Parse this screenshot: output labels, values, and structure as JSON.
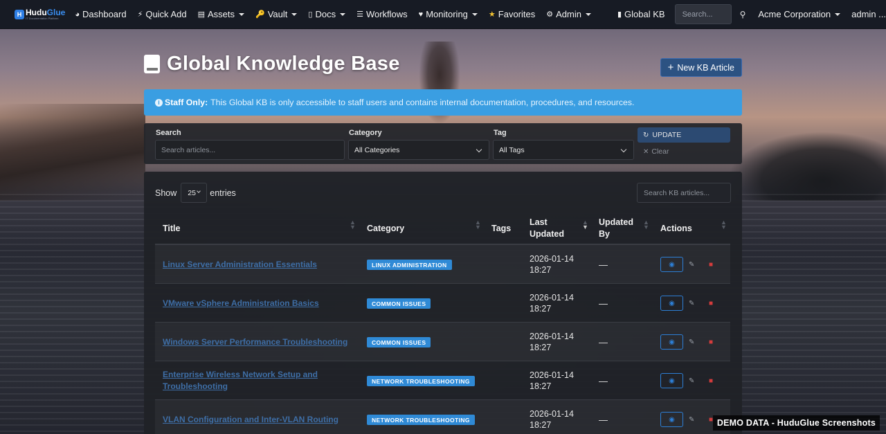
{
  "navbar": {
    "brand": {
      "badge": "H",
      "name_a": "Hudu",
      "name_b": "Glue",
      "tagline": "IT Documentation Platform"
    },
    "items": [
      {
        "icon": "dashboard-icon",
        "glyph": "◕",
        "label": "Dashboard"
      },
      {
        "icon": "bolt-icon",
        "glyph": "⚡",
        "label": "Quick Add"
      },
      {
        "icon": "assets-icon",
        "glyph": "▤",
        "label": "Assets",
        "dropdown": true
      },
      {
        "icon": "key-icon",
        "glyph": "🔑",
        "label": "Vault",
        "dropdown": true
      },
      {
        "icon": "doc-icon",
        "glyph": "▯",
        "label": "Docs",
        "dropdown": true
      },
      {
        "icon": "list-icon",
        "glyph": "☰",
        "label": "Workflows"
      },
      {
        "icon": "heart-icon",
        "glyph": "♥",
        "label": "Monitoring",
        "dropdown": true
      },
      {
        "icon": "star-icon",
        "glyph": "★",
        "label": "Favorites"
      },
      {
        "icon": "gear-icon",
        "glyph": "⚙",
        "label": "Admin",
        "dropdown": true
      }
    ],
    "global_kb": {
      "icon": "book-icon",
      "label": "Global KB"
    },
    "search_placeholder": "Search...",
    "org": "Acme Corporation",
    "user": "admin ..."
  },
  "page": {
    "title": "Global Knowledge Base",
    "new_button": "New KB Article",
    "alert": {
      "strong": "Staff Only:",
      "text": "This Global KB is only accessible to staff users and contains internal documentation, procedures, and resources."
    }
  },
  "filters": {
    "search_label": "Search",
    "search_placeholder": "Search articles...",
    "category_label": "Category",
    "category_value": "All Categories",
    "tag_label": "Tag",
    "tag_value": "All Tags",
    "update": "UPDATE",
    "clear": "Clear"
  },
  "table": {
    "show": "Show",
    "length": "25",
    "entries": "entries",
    "search_placeholder": "Search KB articles...",
    "headers": {
      "title": "Title",
      "category": "Category",
      "tags": "Tags",
      "updated_1": "Last",
      "updated_2": "Updated",
      "by_1": "Updated",
      "by_2": "By",
      "actions": "Actions"
    },
    "rows": [
      {
        "title": "Linux Server Administration Essentials",
        "category": "LINUX ADMINISTRATION",
        "date": "2026-01-14",
        "time": "18:27",
        "by": "—"
      },
      {
        "title": "VMware vSphere Administration Basics",
        "category": "COMMON ISSUES",
        "date": "2026-01-14",
        "time": "18:27",
        "by": "—"
      },
      {
        "title": "Windows Server Performance Troubleshooting",
        "category": "COMMON ISSUES",
        "date": "2026-01-14",
        "time": "18:27",
        "by": "—"
      },
      {
        "title": "Enterprise Wireless Network Setup and Troubleshooting",
        "category": "NETWORK TROUBLESHOOTING",
        "date": "2026-01-14",
        "time": "18:27",
        "by": "—"
      },
      {
        "title": "VLAN Configuration and Inter-VLAN Routing",
        "category": "NETWORK TROUBLESHOOTING",
        "date": "2026-01-14",
        "time": "18:27",
        "by": "—"
      }
    ]
  },
  "demo_banner": "DEMO DATA - HuduGlue Screenshots",
  "colors": {
    "navbar": "#171b24",
    "accent": "#2f8ad6",
    "alert": "#3a9ee2",
    "link": "#3e6ea6",
    "danger": "#d43c3c"
  }
}
